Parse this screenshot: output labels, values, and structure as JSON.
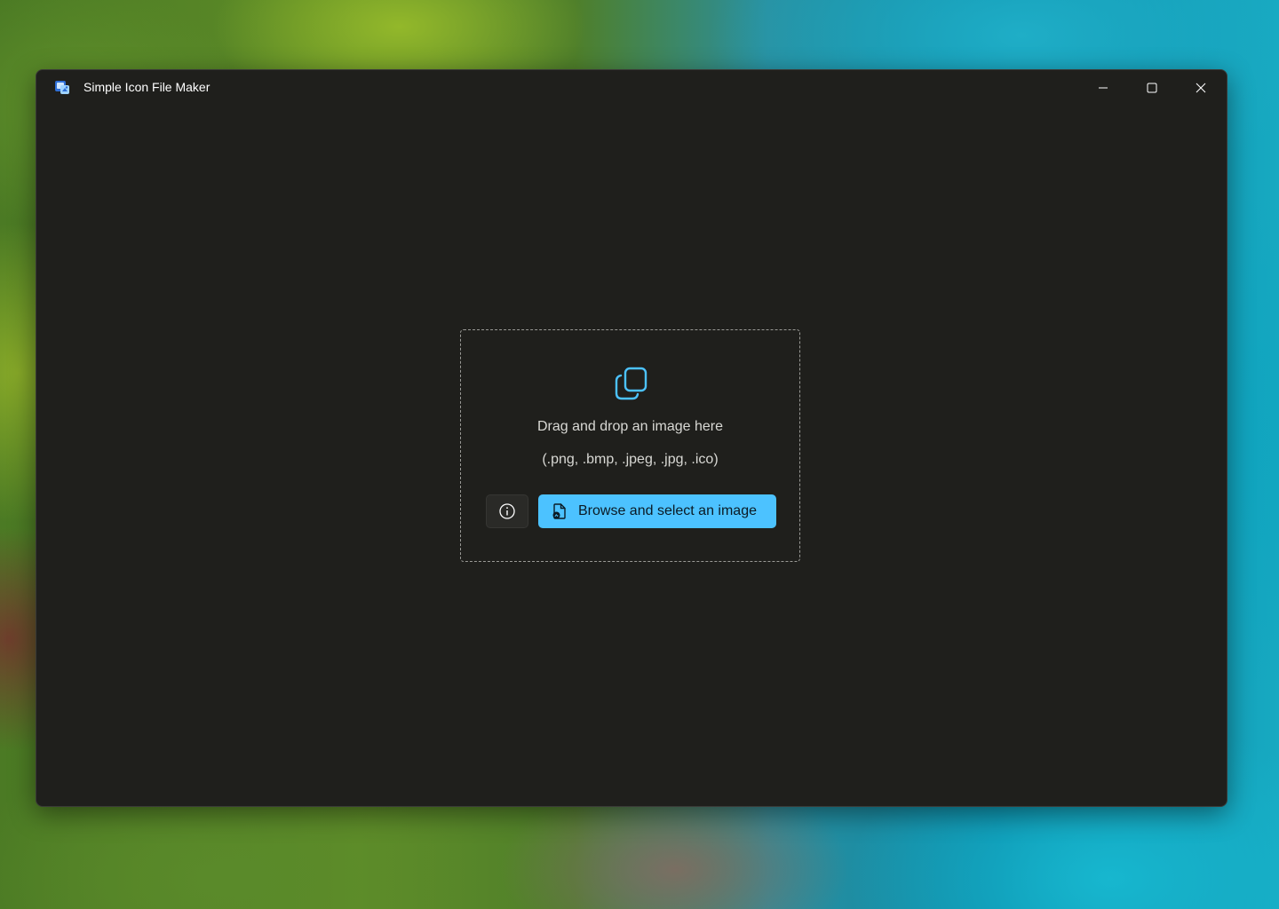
{
  "window": {
    "title": "Simple Icon File Maker",
    "controls": {
      "minimize": "minimize",
      "maximize": "maximize",
      "close": "close"
    }
  },
  "dropzone": {
    "icon": "copy-icon",
    "main_text": "Drag and drop an image here",
    "formats_text": "(.png, .bmp, .jpeg, .jpg, .ico)"
  },
  "actions": {
    "info_icon": "info-icon",
    "browse_icon": "image-file-icon",
    "browse_label": "Browse and select an image"
  },
  "colors": {
    "window_bg": "#1f1f1c",
    "accent": "#4cc2ff",
    "text": "#d8d8d4",
    "title_text": "#ffffff"
  }
}
